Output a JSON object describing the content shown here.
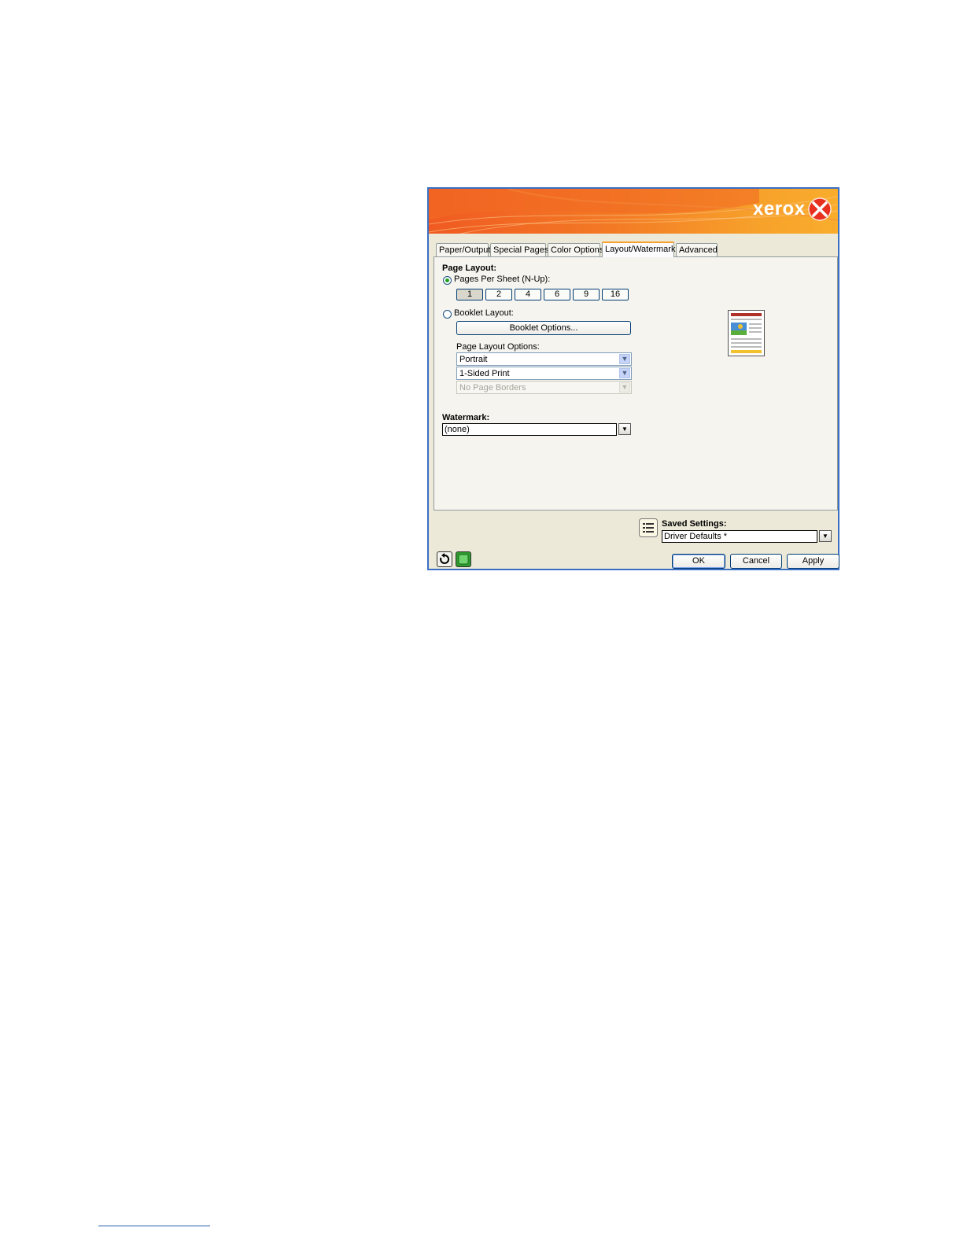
{
  "header": {
    "brand": "xerox"
  },
  "tabs": [
    {
      "label": "Paper/Output"
    },
    {
      "label": "Special Pages"
    },
    {
      "label": "Color Options"
    },
    {
      "label": "Layout/Watermark",
      "active": true
    },
    {
      "label": "Advanced"
    }
  ],
  "page_layout": {
    "heading": "Page Layout:",
    "pages_per_sheet_label": "Pages Per Sheet (N-Up):",
    "pages_per_sheet_selected": true,
    "nup_options": [
      "1",
      "2",
      "4",
      "6",
      "9",
      "16"
    ],
    "nup_selected": "1",
    "booklet_label": "Booklet Layout:",
    "booklet_selected": false,
    "booklet_options_button": "Booklet Options...",
    "options_label": "Page Layout Options:",
    "orientation": "Portrait",
    "sides": "1-Sided Print",
    "borders": "No Page Borders"
  },
  "watermark": {
    "label": "Watermark:",
    "value": "(none)"
  },
  "saved_settings": {
    "label": "Saved Settings:",
    "value": "Driver Defaults *"
  },
  "footer": {
    "ok": "OK",
    "cancel": "Cancel",
    "apply": "Apply"
  },
  "colors": {
    "banner_start": "#f05a22",
    "banner_end": "#f9ad2c",
    "active_tab_accent": "#f7a12b",
    "frame": "#3b6fc4"
  },
  "icons": [
    "xerox-logo-icon",
    "page-preview-icon",
    "saved-settings-icon",
    "reset-icon",
    "status-icon",
    "dropdown-arrow-icon"
  ]
}
